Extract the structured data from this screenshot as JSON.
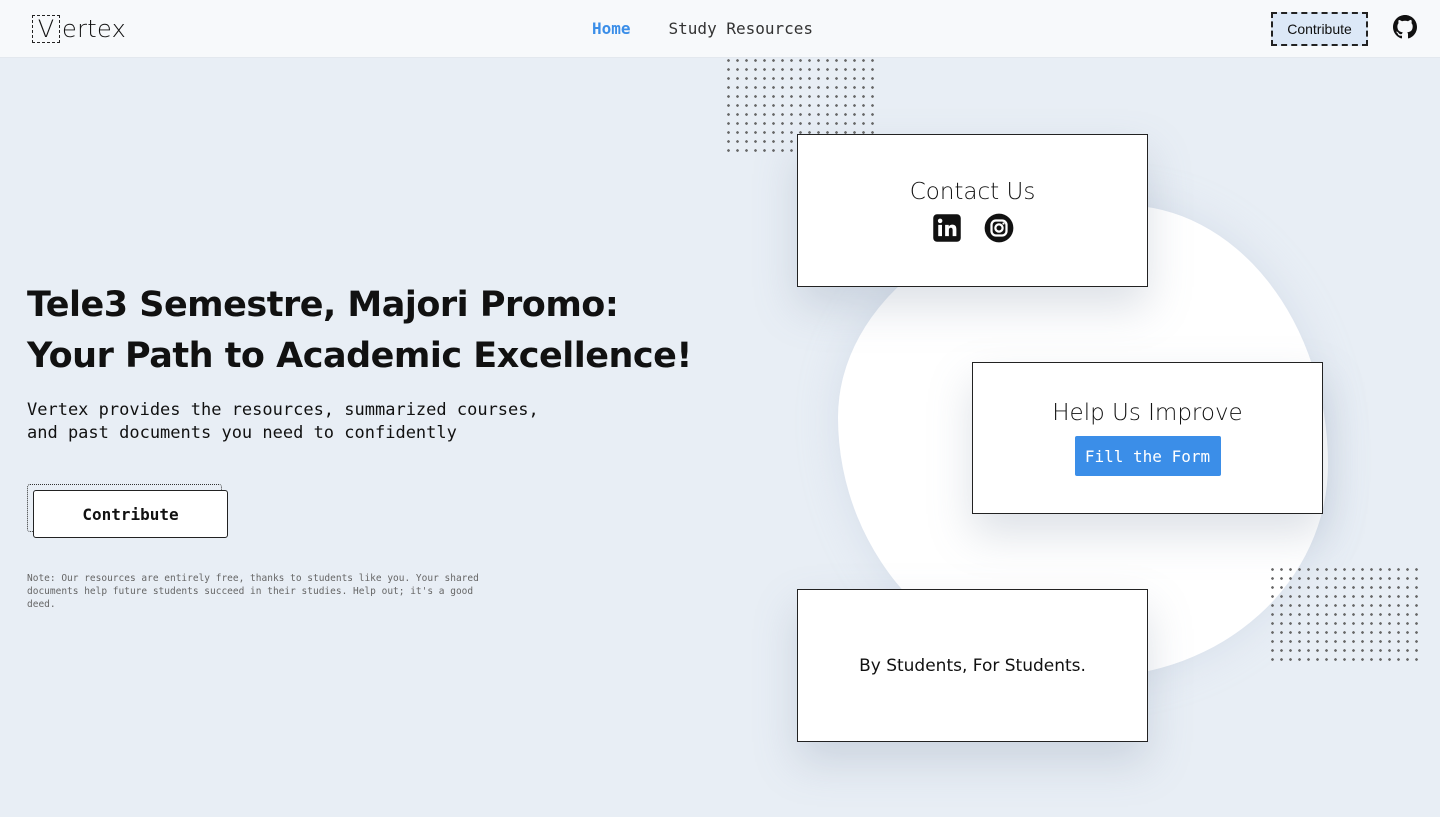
{
  "logo": {
    "boxed_letter": "V",
    "rest": "ertex"
  },
  "nav": {
    "links": [
      {
        "label": "Home",
        "active": true
      },
      {
        "label": "Study Resources",
        "active": false
      }
    ],
    "contribute_label": "Contribute",
    "icons": {
      "github": "github-icon"
    }
  },
  "hero": {
    "title_line1": "Tele3 Semestre, Majori Promo:",
    "title_line2": "Your Path to Academic Excellence!",
    "description_line1": "Vertex provides the resources, summarized courses,",
    "description_line2": "and past documents you need to confidently",
    "contribute_label": "Contribute",
    "note_line1": "Note: Our resources are entirely free, thanks to students like you. Your shared",
    "note_line2": "documents help future students succeed in their studies. Help out; it's a good deed."
  },
  "cards": {
    "contact": {
      "title": "Contact Us",
      "icons": [
        "linkedin-icon",
        "instagram-icon"
      ]
    },
    "improve": {
      "title": "Help Us Improve",
      "button_label": "Fill the Form"
    },
    "tagline": {
      "text": "By Students, For Students."
    }
  },
  "colors": {
    "accent": "#3b8ee8",
    "background": "#e8eef5",
    "nav_button_bg": "#dce8f7"
  }
}
